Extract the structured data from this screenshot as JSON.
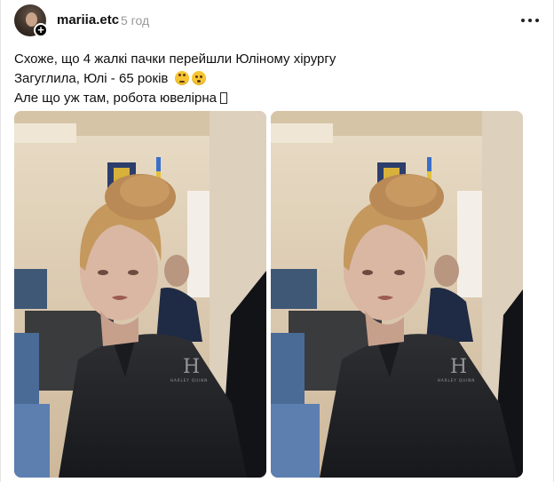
{
  "post": {
    "username": "mariia.etc",
    "timestamp": "5 год",
    "caption_lines": [
      "Схоже, що 4 жалкі пачки перейшли Юліному хірургу",
      "Загуглила, Юлі - 65 років",
      "Але що уж там, робота ювелірна"
    ],
    "emojis": [
      "rolling-eyes-emoji",
      "hushed-face-emoji"
    ],
    "more_button": "more-options"
  },
  "images": [
    {
      "watermark": "HARLEY QUINN"
    },
    {
      "watermark": "HARLEY QUINN"
    }
  ],
  "colors": {
    "text": "#101010",
    "muted": "#999999",
    "background": "#ffffff"
  }
}
